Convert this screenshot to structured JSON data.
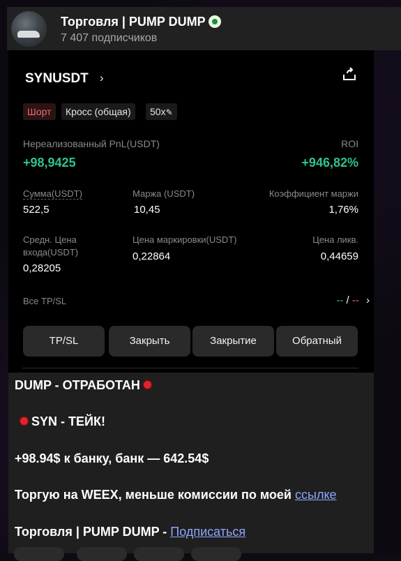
{
  "channel": {
    "title": "Торговля | PUMP DUMP",
    "subscribers": "7 407 подписчиков"
  },
  "position": {
    "pair": "SYNUSDT",
    "tags": {
      "side": "Шорт",
      "margin_mode": "Кросс (общая)",
      "leverage": "50x"
    },
    "pnl_label": "Нереализованный PnL(USDT)",
    "pnl_value": "+98,9425",
    "roi_label": "ROI",
    "roi_value": "+946,82%",
    "amount_label": "Сумма(USDT)",
    "amount_value": "522,5",
    "margin_label": "Маржа (USDT)",
    "margin_value": "10,45",
    "margin_ratio_label": "Коэффициент маржи",
    "margin_ratio_value": "1,76%",
    "entry_label_1": "Средн. Цена",
    "entry_label_2": "входа(USDT)",
    "entry_value": "0,28205",
    "mark_label": "Цена маркировки(USDT)",
    "mark_value": "0,22864",
    "liq_label": "Цена ликв.",
    "liq_value": "0,44659",
    "tpsl_label": "Все TP/SL",
    "tpsl_tp": "--",
    "tpsl_sep": "/",
    "tpsl_sl": "--",
    "buttons": {
      "tpsl": "TP/SL",
      "close": "Закрыть",
      "close_all": "Закрытие",
      "reverse": "Обратный"
    }
  },
  "message": {
    "line1": "DUMP - ОТРАБОТАН",
    "line2": "SYN - ТЕЙК!",
    "line3": "+98.94$ к банку, банк — 642.54$",
    "line4_text": "Торгую на WEEX, меньше комиссии по моей ",
    "line4_link": "ссылке",
    "line5_text": "Торговля | PUMP DUMP - ",
    "line5_link": "Подписаться"
  },
  "colors": {
    "profit": "#2fc38a",
    "loss": "#f06a6a",
    "link": "#8ea6ff"
  }
}
